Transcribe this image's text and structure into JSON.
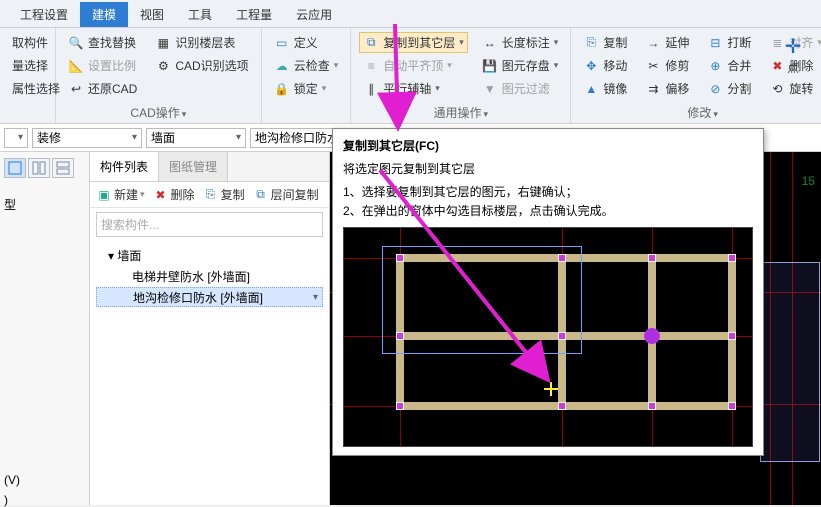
{
  "menu": {
    "tabs": [
      "工程设置",
      "建模",
      "视图",
      "工具",
      "工程量",
      "云应用"
    ],
    "active": 1
  },
  "ribbon": {
    "g1": {
      "items": [
        "取构件",
        "量选择",
        "属性选择"
      ]
    },
    "g2": {
      "items": [
        {
          "t": "查找替换",
          "d": false
        },
        {
          "t": "识别楼层表",
          "d": false
        },
        {
          "t": "设置比例",
          "d": true
        },
        {
          "t": "CAD识别选项",
          "d": false
        },
        {
          "t": "还原CAD",
          "d": false
        }
      ],
      "label": "CAD操作"
    },
    "g3": {
      "items": [
        "定义",
        "云检查",
        "锁定"
      ],
      "label": ""
    },
    "g4": {
      "items": [
        {
          "t": "复制到其它层",
          "hl": true
        },
        {
          "t": "自动平齐顶",
          "d": true
        },
        {
          "t": "平行辅轴",
          "d": false
        }
      ],
      "extra": [
        "长度标注",
        "图元存盘",
        "图元过滤"
      ],
      "label": "通用操作"
    },
    "g5": {
      "row1": [
        "复制",
        "延伸",
        "打断",
        "对齐"
      ],
      "row2": [
        "移动",
        "修剪",
        "合并",
        "删除"
      ],
      "row3": [
        "镜像",
        "偏移",
        "分割",
        "旋转"
      ],
      "label": "修改"
    },
    "point": "点"
  },
  "selects": {
    "s1": "装修",
    "s2": "墙面",
    "s3": "地沟检修口防水"
  },
  "left": {
    "t1": "型",
    "t2": "(V)",
    "t3": ")"
  },
  "panel": {
    "tabs": [
      "构件列表",
      "图纸管理"
    ],
    "tools": [
      "新建",
      "删除",
      "复制",
      "层间复制"
    ],
    "search": "搜索构件...",
    "root": "墙面",
    "children": [
      "电梯井壁防水 [外墙面]",
      "地沟检修口防水 [外墙面]"
    ]
  },
  "tooltip": {
    "title": "复制到其它层(FC)",
    "sub": "将选定图元复制到其它层",
    "l1": "1、选择要复制到其它层的图元，右键确认；",
    "l2": "2、在弹出的窗体中勾选目标楼层，点击确认完成。"
  },
  "canvas": {
    "dim": "15"
  }
}
